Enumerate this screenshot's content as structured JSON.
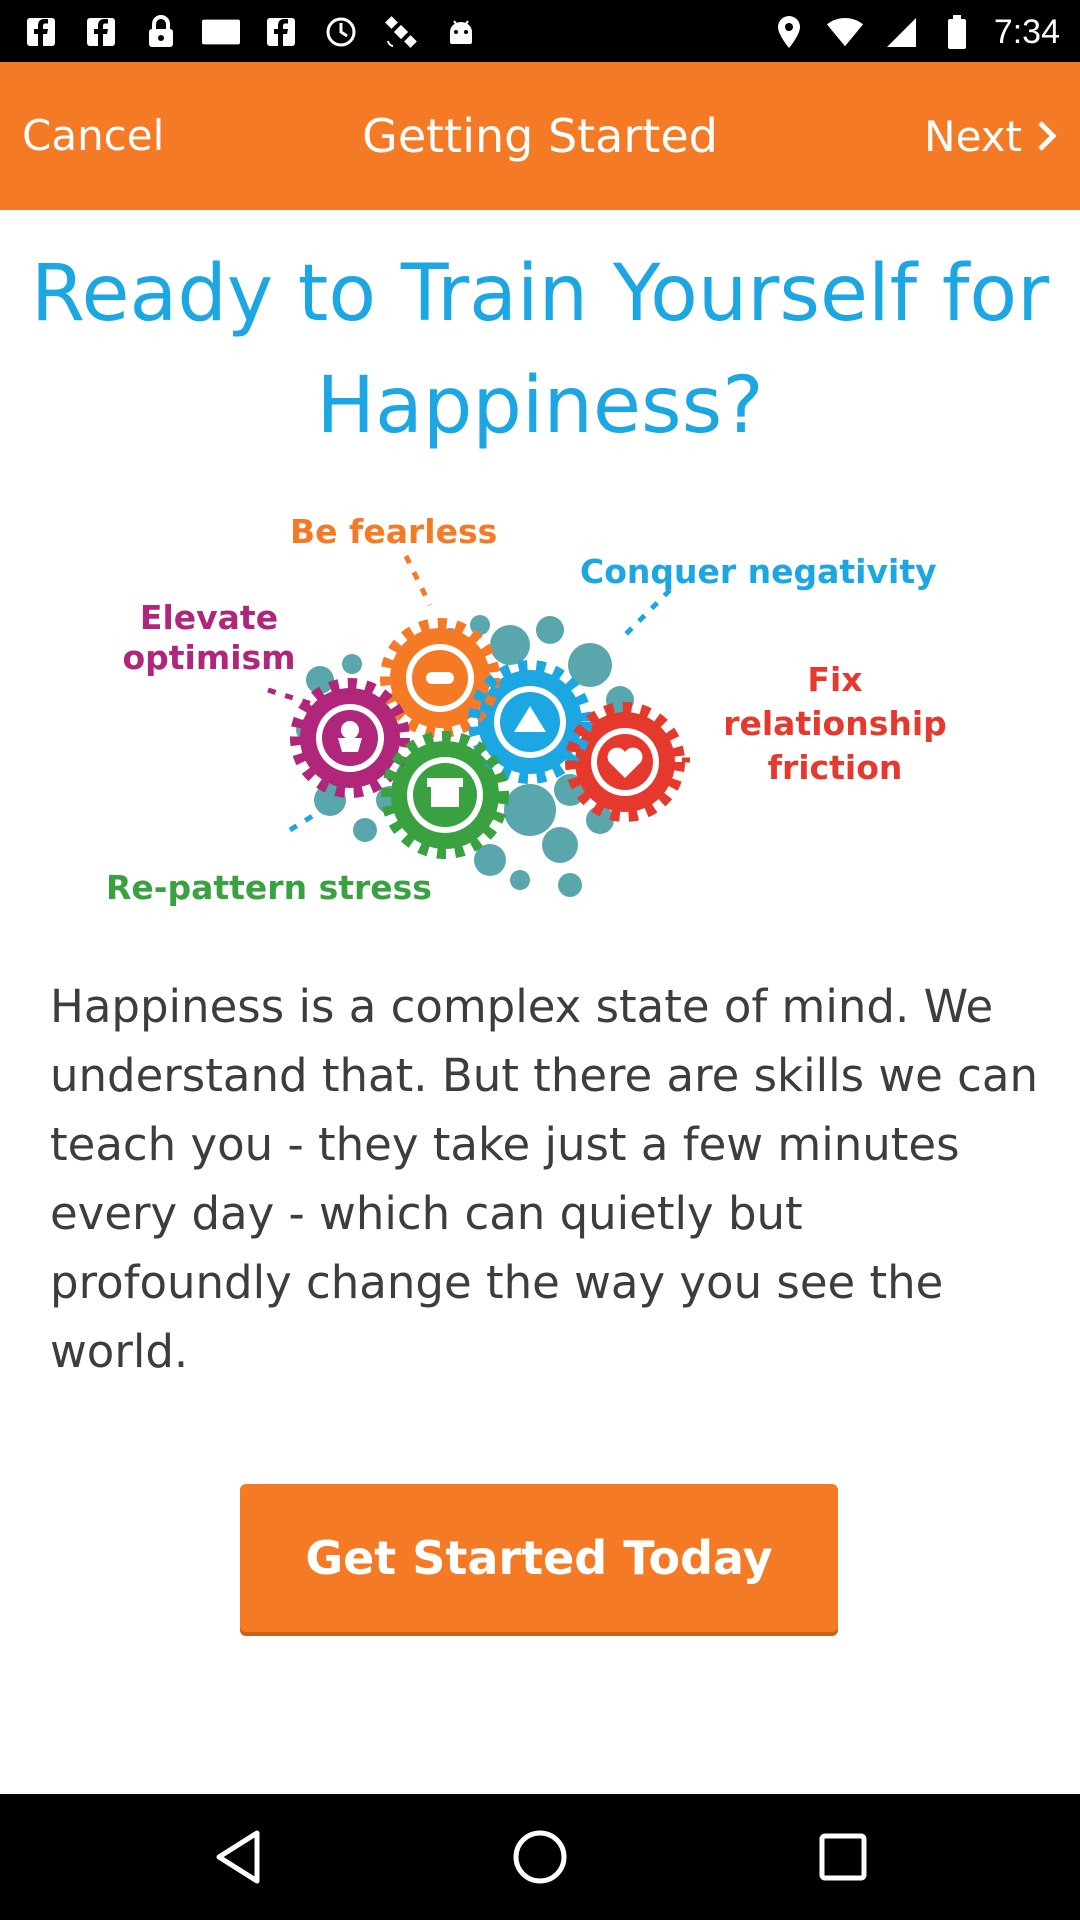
{
  "status_bar": {
    "time": "7:34",
    "left_icons": [
      "facebook-icon",
      "facebook-icon",
      "lock-icon",
      "blank-notification-icon",
      "facebook-icon",
      "sync-icon",
      "satellite-icon",
      "android-icon"
    ],
    "right_icons": [
      "location-icon",
      "wifi-icon",
      "signal-icon",
      "battery-icon"
    ]
  },
  "app_bar": {
    "cancel_label": "Cancel",
    "title": "Getting Started",
    "next_label": "Next",
    "background": "#f57a25"
  },
  "headline": "Ready to Train Yourself for Happiness?",
  "illustration": {
    "labels": {
      "be_fearless": "Be fearless",
      "conquer_negativity": "Conquer negativity",
      "elevate_line1": "Elevate",
      "elevate_line2": "optimism",
      "fix_line1": "Fix",
      "fix_line2": "relationship",
      "fix_line3": "friction",
      "repattern_stress": "Re-pattern stress"
    },
    "gear_colors": {
      "orange": "#f57a25",
      "blue": "#1ca6e2",
      "purple": "#b0267a",
      "red": "#e6392e",
      "green": "#3aa141",
      "teal": "#5aa6ad"
    }
  },
  "body_text": "Happiness is a complex state of mind. We understand that. But there are skills we can teach you - they take just a few minutes every day - which can quietly but profoundly change the way you see the world.",
  "cta": {
    "label": "Get Started Today"
  },
  "nav_bar": {
    "buttons": [
      "back-icon",
      "home-icon",
      "recents-icon"
    ]
  }
}
